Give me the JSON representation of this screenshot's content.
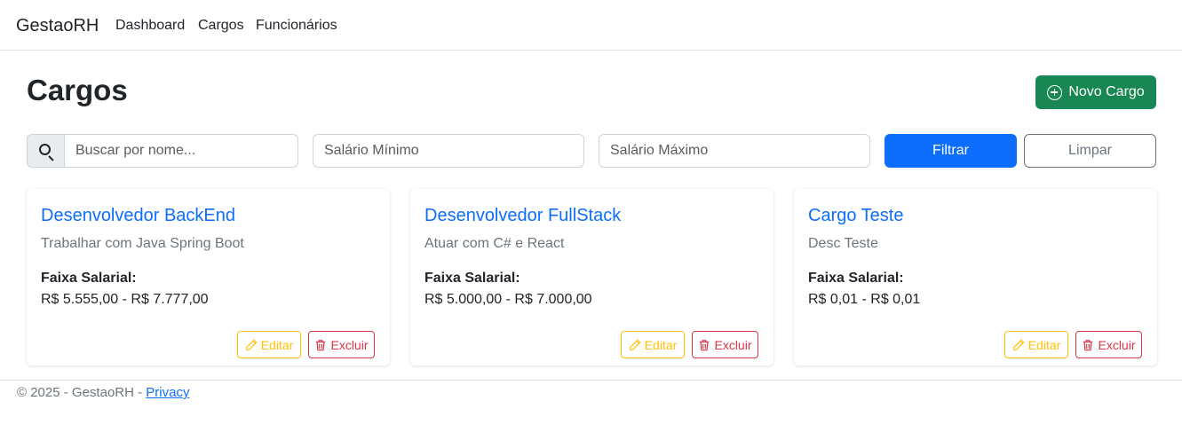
{
  "navbar": {
    "brand": "GestaoRH",
    "links": [
      "Dashboard",
      "Cargos",
      "Funcionários"
    ]
  },
  "page": {
    "title": "Cargos",
    "new_button": "Novo Cargo"
  },
  "filters": {
    "search_placeholder": "Buscar por nome...",
    "search_value": "",
    "min_salary_placeholder": "Salário Mínimo",
    "min_salary_value": "",
    "max_salary_placeholder": "Salário Máximo",
    "max_salary_value": "",
    "filter_button": "Filtrar",
    "clear_button": "Limpar"
  },
  "cards": [
    {
      "title": "Desenvolvedor BackEnd",
      "description": "Trabalhar com Java Spring Boot",
      "salary_label": "Faixa Salarial:",
      "salary_range": "R$ 5.555,00 - R$ 7.777,00",
      "edit_label": "Editar",
      "delete_label": "Excluir"
    },
    {
      "title": "Desenvolvedor FullStack",
      "description": "Atuar com C# e React",
      "salary_label": "Faixa Salarial:",
      "salary_range": "R$ 5.000,00 - R$ 7.000,00",
      "edit_label": "Editar",
      "delete_label": "Excluir"
    },
    {
      "title": "Cargo Teste",
      "description": "Desc Teste",
      "salary_label": "Faixa Salarial:",
      "salary_range": "R$ 0,01 - R$ 0,01",
      "edit_label": "Editar",
      "delete_label": "Excluir"
    }
  ],
  "footer": {
    "text": "© 2025 - GestaoRH - ",
    "privacy_link": "Privacy"
  },
  "colors": {
    "primary": "#0d6efd",
    "success": "#198754",
    "warning": "#ffc107",
    "danger": "#dc3545",
    "secondary": "#6c757d"
  },
  "icons": {
    "new_button": "plus-circle-icon",
    "search": "search-icon",
    "edit": "pencil-icon",
    "delete": "trash-icon"
  }
}
